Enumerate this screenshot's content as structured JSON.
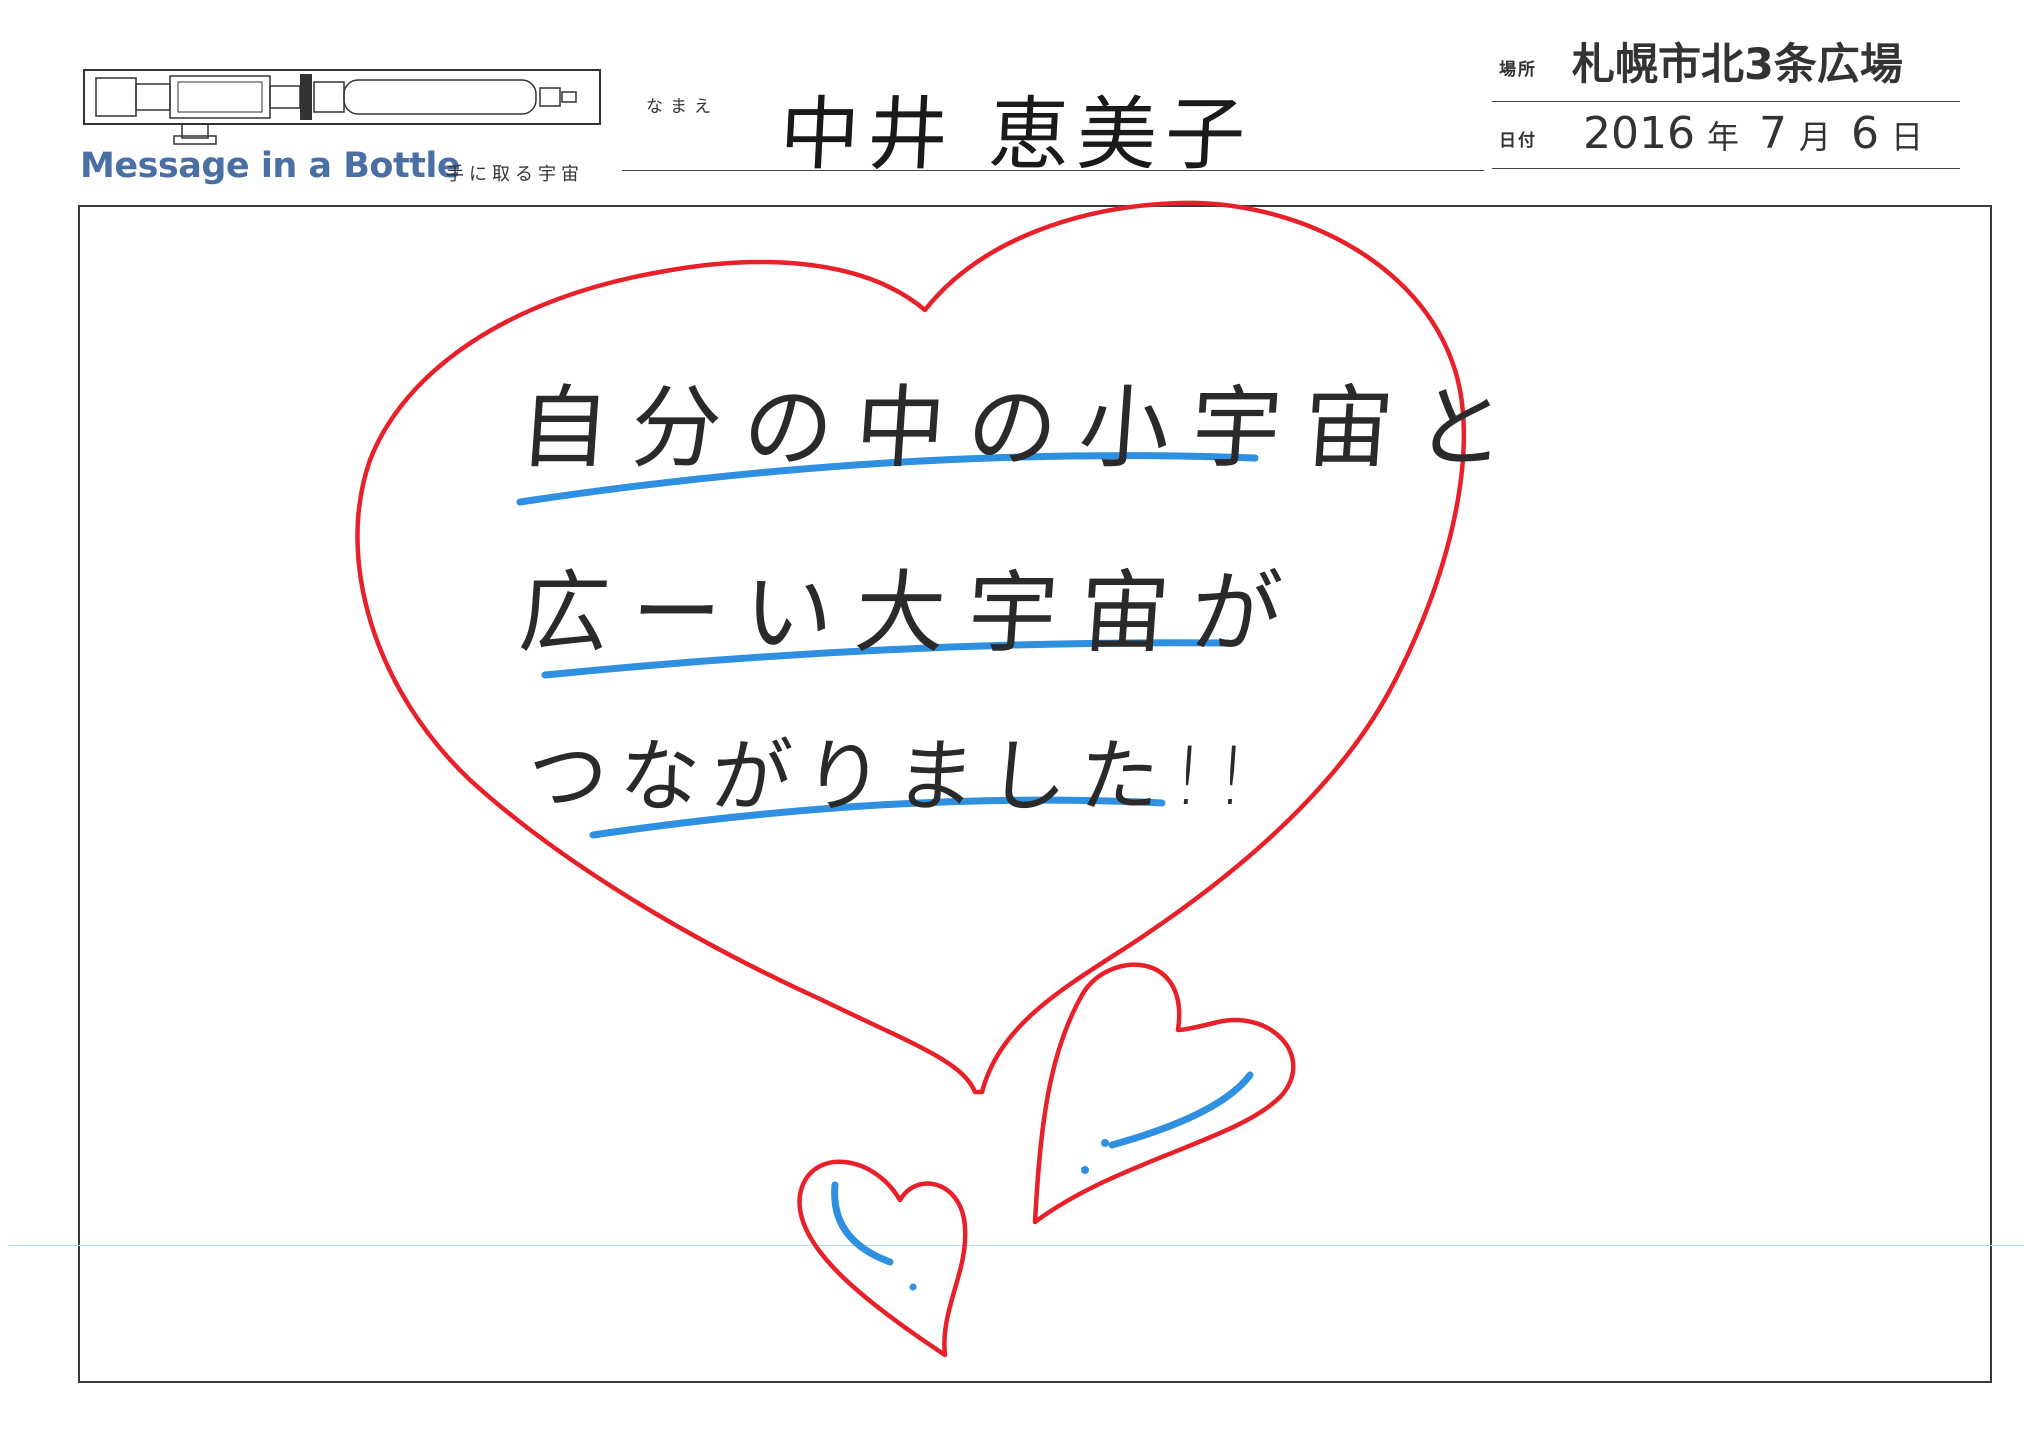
{
  "header": {
    "brand": "Message in a Bottle",
    "tagline": "手に取る宇宙",
    "name_label": "なまえ",
    "name_value": "中井 恵美子",
    "place_label": "場所",
    "place_value": "札幌市北3条広場",
    "date_label": "日付",
    "date": {
      "year": "2016",
      "year_unit": "年",
      "month": "7",
      "month_unit": "月",
      "day": "6",
      "day_unit": "日"
    }
  },
  "message": {
    "lines": [
      "自分の中の小宇宙と",
      "広ーい大宇宙が",
      "つながりました!!"
    ]
  },
  "colors": {
    "heart": "#e8202a",
    "underline": "#2f8fe0",
    "brand": "#4a6fa5",
    "guide": "#a8e2f0"
  }
}
